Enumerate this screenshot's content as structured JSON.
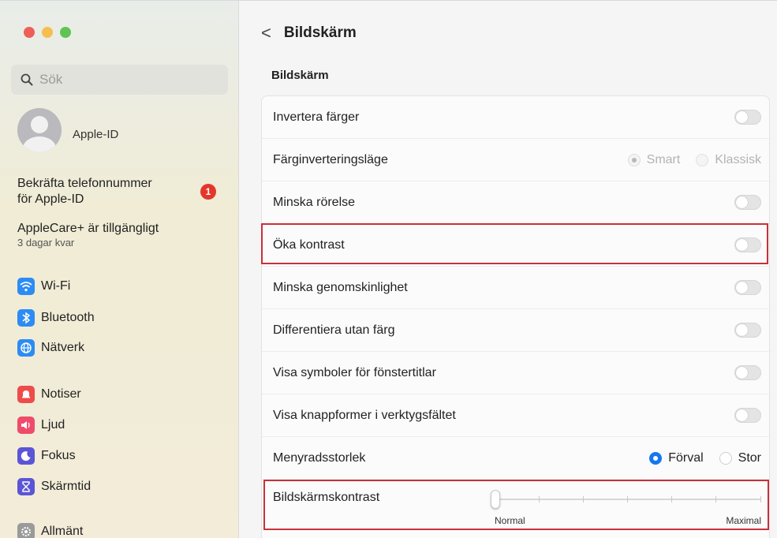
{
  "sidebar": {
    "search_placeholder": "Sök",
    "apple_id_label": "Apple-ID",
    "notice": {
      "line1": "Bekräfta telefonnummer",
      "line2": "för Apple-ID",
      "badge": "1"
    },
    "applecare": {
      "title": "AppleCare+ är tillgängligt",
      "subtitle": "3 dagar kvar"
    },
    "items": [
      {
        "label": "Wi-Fi",
        "icon": "wifi-icon"
      },
      {
        "label": "Bluetooth",
        "icon": "bluetooth-icon"
      },
      {
        "label": "Nätverk",
        "icon": "globe-icon"
      },
      {
        "label": "Notiser",
        "icon": "bell-icon"
      },
      {
        "label": "Ljud",
        "icon": "speaker-icon"
      },
      {
        "label": "Fokus",
        "icon": "moon-icon"
      },
      {
        "label": "Skärmtid",
        "icon": "hourglass-icon"
      },
      {
        "label": "Allmänt",
        "icon": "gear-icon"
      }
    ]
  },
  "header": {
    "back": "<",
    "title": "Bildskärm"
  },
  "section_title": "Bildskärm",
  "settings": [
    {
      "label": "Invertera färger",
      "type": "toggle",
      "on": false
    },
    {
      "label": "Färginverteringsläge",
      "type": "radio",
      "options": [
        "Smart",
        "Klassisk"
      ],
      "selected": "Smart",
      "disabled": true
    },
    {
      "label": "Minska rörelse",
      "type": "toggle",
      "on": false
    },
    {
      "label": "Öka kontrast",
      "type": "toggle",
      "on": false,
      "highlighted": true
    },
    {
      "label": "Minska genomskinlighet",
      "type": "toggle",
      "on": false
    },
    {
      "label": "Differentiera utan färg",
      "type": "toggle",
      "on": false
    },
    {
      "label": "Visa symboler för fönstertitlar",
      "type": "toggle",
      "on": false
    },
    {
      "label": "Visa knappformer i verktygsfältet",
      "type": "toggle",
      "on": false
    },
    {
      "label": "Menyradsstorlek",
      "type": "radio",
      "options": [
        "Förval",
        "Stor"
      ],
      "selected": "Förval",
      "disabled": false
    },
    {
      "label": "Bildskärmskontrast",
      "type": "slider",
      "min_label": "Normal",
      "max_label": "Maximal",
      "value": 0,
      "highlighted": true
    }
  ],
  "colors": {
    "accent": "#1677ee",
    "highlight": "#c8313a",
    "badge": "#e5362c"
  }
}
